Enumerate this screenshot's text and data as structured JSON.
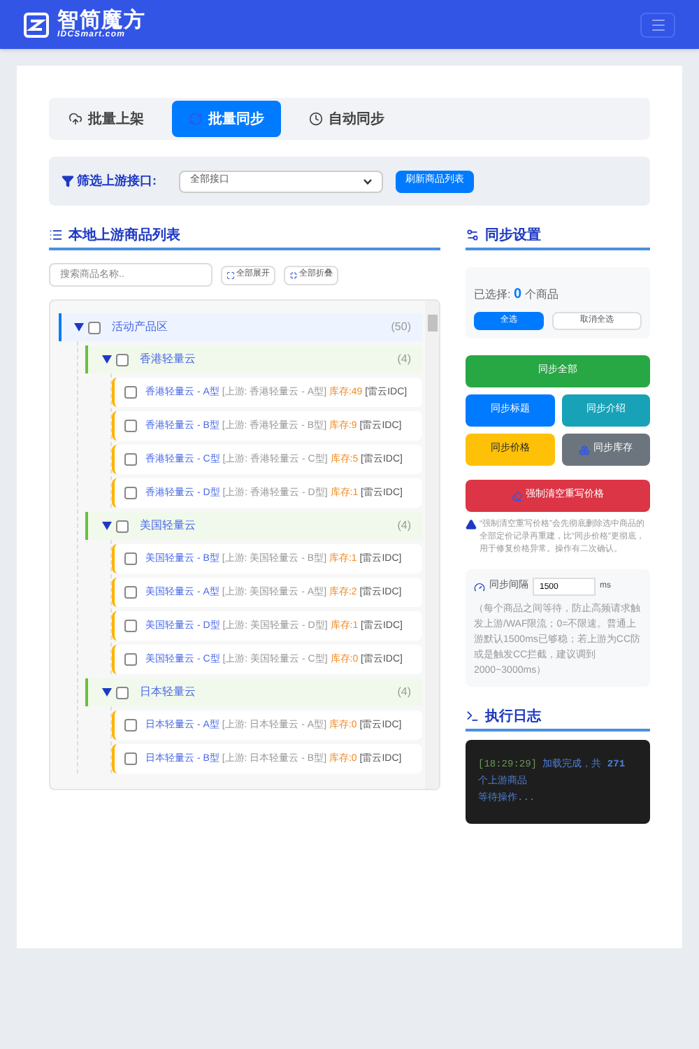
{
  "header": {
    "logo_title": "智简魔方",
    "logo_subtitle": "IDCSmart.com"
  },
  "tabs": [
    {
      "label": "批量上架",
      "selected": false
    },
    {
      "label": "批量同步",
      "selected": true
    },
    {
      "label": "自动同步",
      "selected": false
    }
  ],
  "filter": {
    "label": "筛选上游接口:",
    "select_value": "全部接口",
    "refresh_button": "刷新商品列表"
  },
  "product_list": {
    "title": "本地上游商品列表",
    "search_placeholder": "搜索商品名称..",
    "expand_all": "全部展开",
    "collapse_all": "全部折叠",
    "tree": [
      {
        "name": "活动产品区",
        "count": "(50)",
        "checked": false,
        "expanded": true,
        "children": [
          {
            "name": "香港轻量云",
            "count": "(4)",
            "checked": false,
            "expanded": true,
            "children": [
              {
                "name": "香港轻量云 - A型",
                "upstream": "[上游: 香港轻量云 - A型]",
                "stock": "库存:49",
                "source": "[雷云IDC]",
                "checked": false
              },
              {
                "name": "香港轻量云 - B型",
                "upstream": "[上游: 香港轻量云 - B型]",
                "stock": "库存:9",
                "source": "[雷云IDC]",
                "checked": false
              },
              {
                "name": "香港轻量云 - C型",
                "upstream": "[上游: 香港轻量云 - C型]",
                "stock": "库存:5",
                "source": "[雷云IDC]",
                "checked": false
              },
              {
                "name": "香港轻量云 - D型",
                "upstream": "[上游: 香港轻量云 - D型]",
                "stock": "库存:1",
                "source": "[雷云IDC]",
                "checked": false
              }
            ]
          },
          {
            "name": "美国轻量云",
            "count": "(4)",
            "checked": false,
            "expanded": true,
            "children": [
              {
                "name": "美国轻量云 - B型",
                "upstream": "[上游: 美国轻量云 - B型]",
                "stock": "库存:1",
                "source": "[雷云IDC]",
                "checked": false
              },
              {
                "name": "美国轻量云 - A型",
                "upstream": "[上游: 美国轻量云 - A型]",
                "stock": "库存:2",
                "source": "[雷云IDC]",
                "checked": false
              },
              {
                "name": "美国轻量云 - D型",
                "upstream": "[上游: 美国轻量云 - D型]",
                "stock": "库存:1",
                "source": "[雷云IDC]",
                "checked": false
              },
              {
                "name": "美国轻量云 - C型",
                "upstream": "[上游: 美国轻量云 - C型]",
                "stock": "库存:0",
                "source": "[雷云IDC]",
                "checked": false
              }
            ]
          },
          {
            "name": "日本轻量云",
            "count": "(4)",
            "checked": false,
            "expanded": true,
            "children": [
              {
                "name": "日本轻量云 - A型",
                "upstream": "[上游: 日本轻量云 - A型]",
                "stock": "库存:0",
                "source": "[雷云IDC]",
                "checked": false
              },
              {
                "name": "日本轻量云 - B型",
                "upstream": "[上游: 日本轻量云 - B型]",
                "stock": "库存:0",
                "source": "[雷云IDC]",
                "checked": false
              }
            ]
          }
        ]
      }
    ]
  },
  "sync_settings": {
    "title": "同步设置",
    "selected_prefix": "已选择:",
    "selected_count": "0",
    "selected_suffix": "个商品",
    "select_all": "全选",
    "deselect_all": "取消全选",
    "buttons": [
      {
        "label": "同步全部",
        "kind": "success"
      },
      {
        "label": "同步标题",
        "kind": "primary"
      },
      {
        "label": "同步介绍",
        "kind": "info"
      },
      {
        "label": "同步价格",
        "kind": "warning"
      },
      {
        "label": "同步库存",
        "kind": "secondary"
      },
      {
        "label": "强制清空重写价格",
        "kind": "danger"
      }
    ],
    "warning_note": "“强制清空重写价格”会先彻底删除选中商品的全部定价记录再重建，比“同步价格”更彻底，用于修复价格异常。操作有二次确认。",
    "interval": {
      "label": "同步间隔",
      "value": "1500",
      "unit": "ms",
      "note": "（每个商品之间等待，防止高频请求触发上游/WAF限流；0=不限速。普通上游默认1500ms已够稳；若上游为CC防或是触发CC拦截，建议调到2000~3000ms）"
    }
  },
  "log": {
    "title": "执行日志",
    "lines": [
      {
        "time": "[18:29:29]",
        "text": "加载完成，共 **271** 个上游商品"
      },
      {
        "text": "等待操作..."
      }
    ]
  }
}
